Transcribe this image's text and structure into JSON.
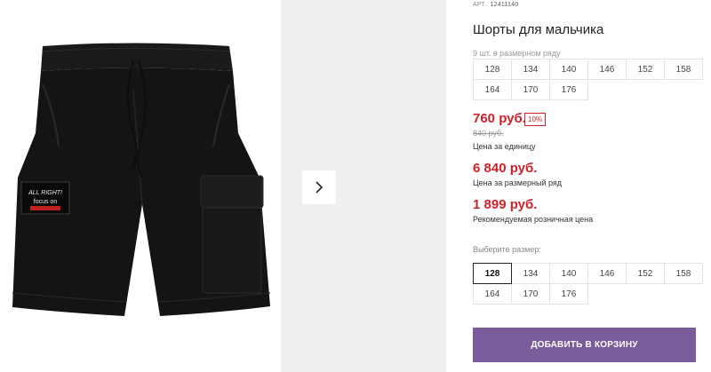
{
  "product": {
    "sku_label": "АРТ.:",
    "sku_value": "12411140",
    "title": "Шорты для мальчика",
    "image_patch_text": [
      "ALL RIGHT!",
      "focus on"
    ]
  },
  "pack": {
    "label": "9 шт. в размерном ряду",
    "sizes": [
      "128",
      "134",
      "140",
      "146",
      "152",
      "158",
      "164",
      "170",
      "176"
    ]
  },
  "prices": {
    "unit_price": "760 руб.",
    "discount": "10%",
    "old_price": "840 руб.",
    "unit_label": "Цена за единицу",
    "pack_price": "6 840 руб.",
    "pack_label": "Цена за размерный ряд",
    "rrp_price": "1 899 руб.",
    "rrp_label": "Рекомендуемая розничная цена"
  },
  "size_select": {
    "label": "Выберите размер:",
    "sizes": [
      "128",
      "134",
      "140",
      "146",
      "152",
      "158",
      "164",
      "170",
      "176"
    ],
    "selected": "128"
  },
  "cart": {
    "button_label": "ДОБАВИТЬ В КОРЗИНУ"
  },
  "colors": {
    "price_red": "#d0202a",
    "button_purple": "#7a5c9a",
    "side_bg": "#efefef"
  },
  "icons": {
    "next": "chevron-right-icon"
  }
}
